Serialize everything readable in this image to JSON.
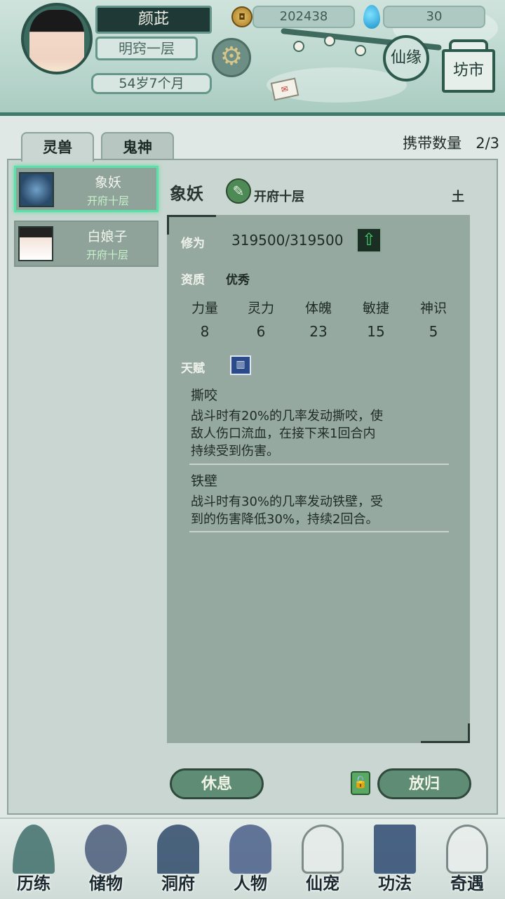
{
  "header": {
    "player_name": "颜茈",
    "realm": "明窍一层",
    "age": "54岁7个月",
    "currency_amount": "202438",
    "gem_amount": "30",
    "xianyuan_label": "仙缘",
    "fangshi_label": "坊市"
  },
  "tabs": [
    {
      "label": "灵兽",
      "active": true
    },
    {
      "label": "鬼神",
      "active": false
    }
  ],
  "carry": {
    "label": "携带数量",
    "value": "2/3"
  },
  "pets": [
    {
      "name": "象妖",
      "level": "开府十层",
      "selected": true
    },
    {
      "name": "白娘子",
      "level": "开府十层",
      "selected": false
    }
  ],
  "detail": {
    "name": "象妖",
    "level": "开府十层",
    "element": "土",
    "cultivation_label": "修为",
    "cultivation_value": "319500/319500",
    "aptitude_label": "资质",
    "aptitude_value": "优秀",
    "stats": [
      {
        "label": "力量",
        "value": "8"
      },
      {
        "label": "灵力",
        "value": "6"
      },
      {
        "label": "体魄",
        "value": "23"
      },
      {
        "label": "敏捷",
        "value": "15"
      },
      {
        "label": "神识",
        "value": "5"
      }
    ],
    "talent_label": "天赋",
    "talents": [
      {
        "name": "撕咬",
        "line1": "战斗时有20%的几率发动撕咬，使",
        "line2": "敌人伤口流血，在接下来1回合内",
        "line3": "持续受到伤害。"
      },
      {
        "name": "铁壁",
        "line1": "战斗时有30%的几率发动铁壁，受",
        "line2": "到的伤害降低30%，持续2回合。"
      }
    ]
  },
  "actions": {
    "rest": "休息",
    "release": "放归"
  },
  "bottom_nav": [
    {
      "label": "历练",
      "icon": "mountain-icon"
    },
    {
      "label": "储物",
      "icon": "bag-icon"
    },
    {
      "label": "洞府",
      "icon": "pagoda-icon"
    },
    {
      "label": "人物",
      "icon": "person-icon"
    },
    {
      "label": "仙宠",
      "icon": "ghost-pet-icon"
    },
    {
      "label": "功法",
      "icon": "scroll-book-icon"
    },
    {
      "label": "奇遇",
      "icon": "crane-icon"
    }
  ],
  "colors": {
    "accent": "#3f7a6a",
    "panel": "#cad6d1",
    "selected_glow": "#5be0a8",
    "level_text": "#c7f1c9"
  }
}
